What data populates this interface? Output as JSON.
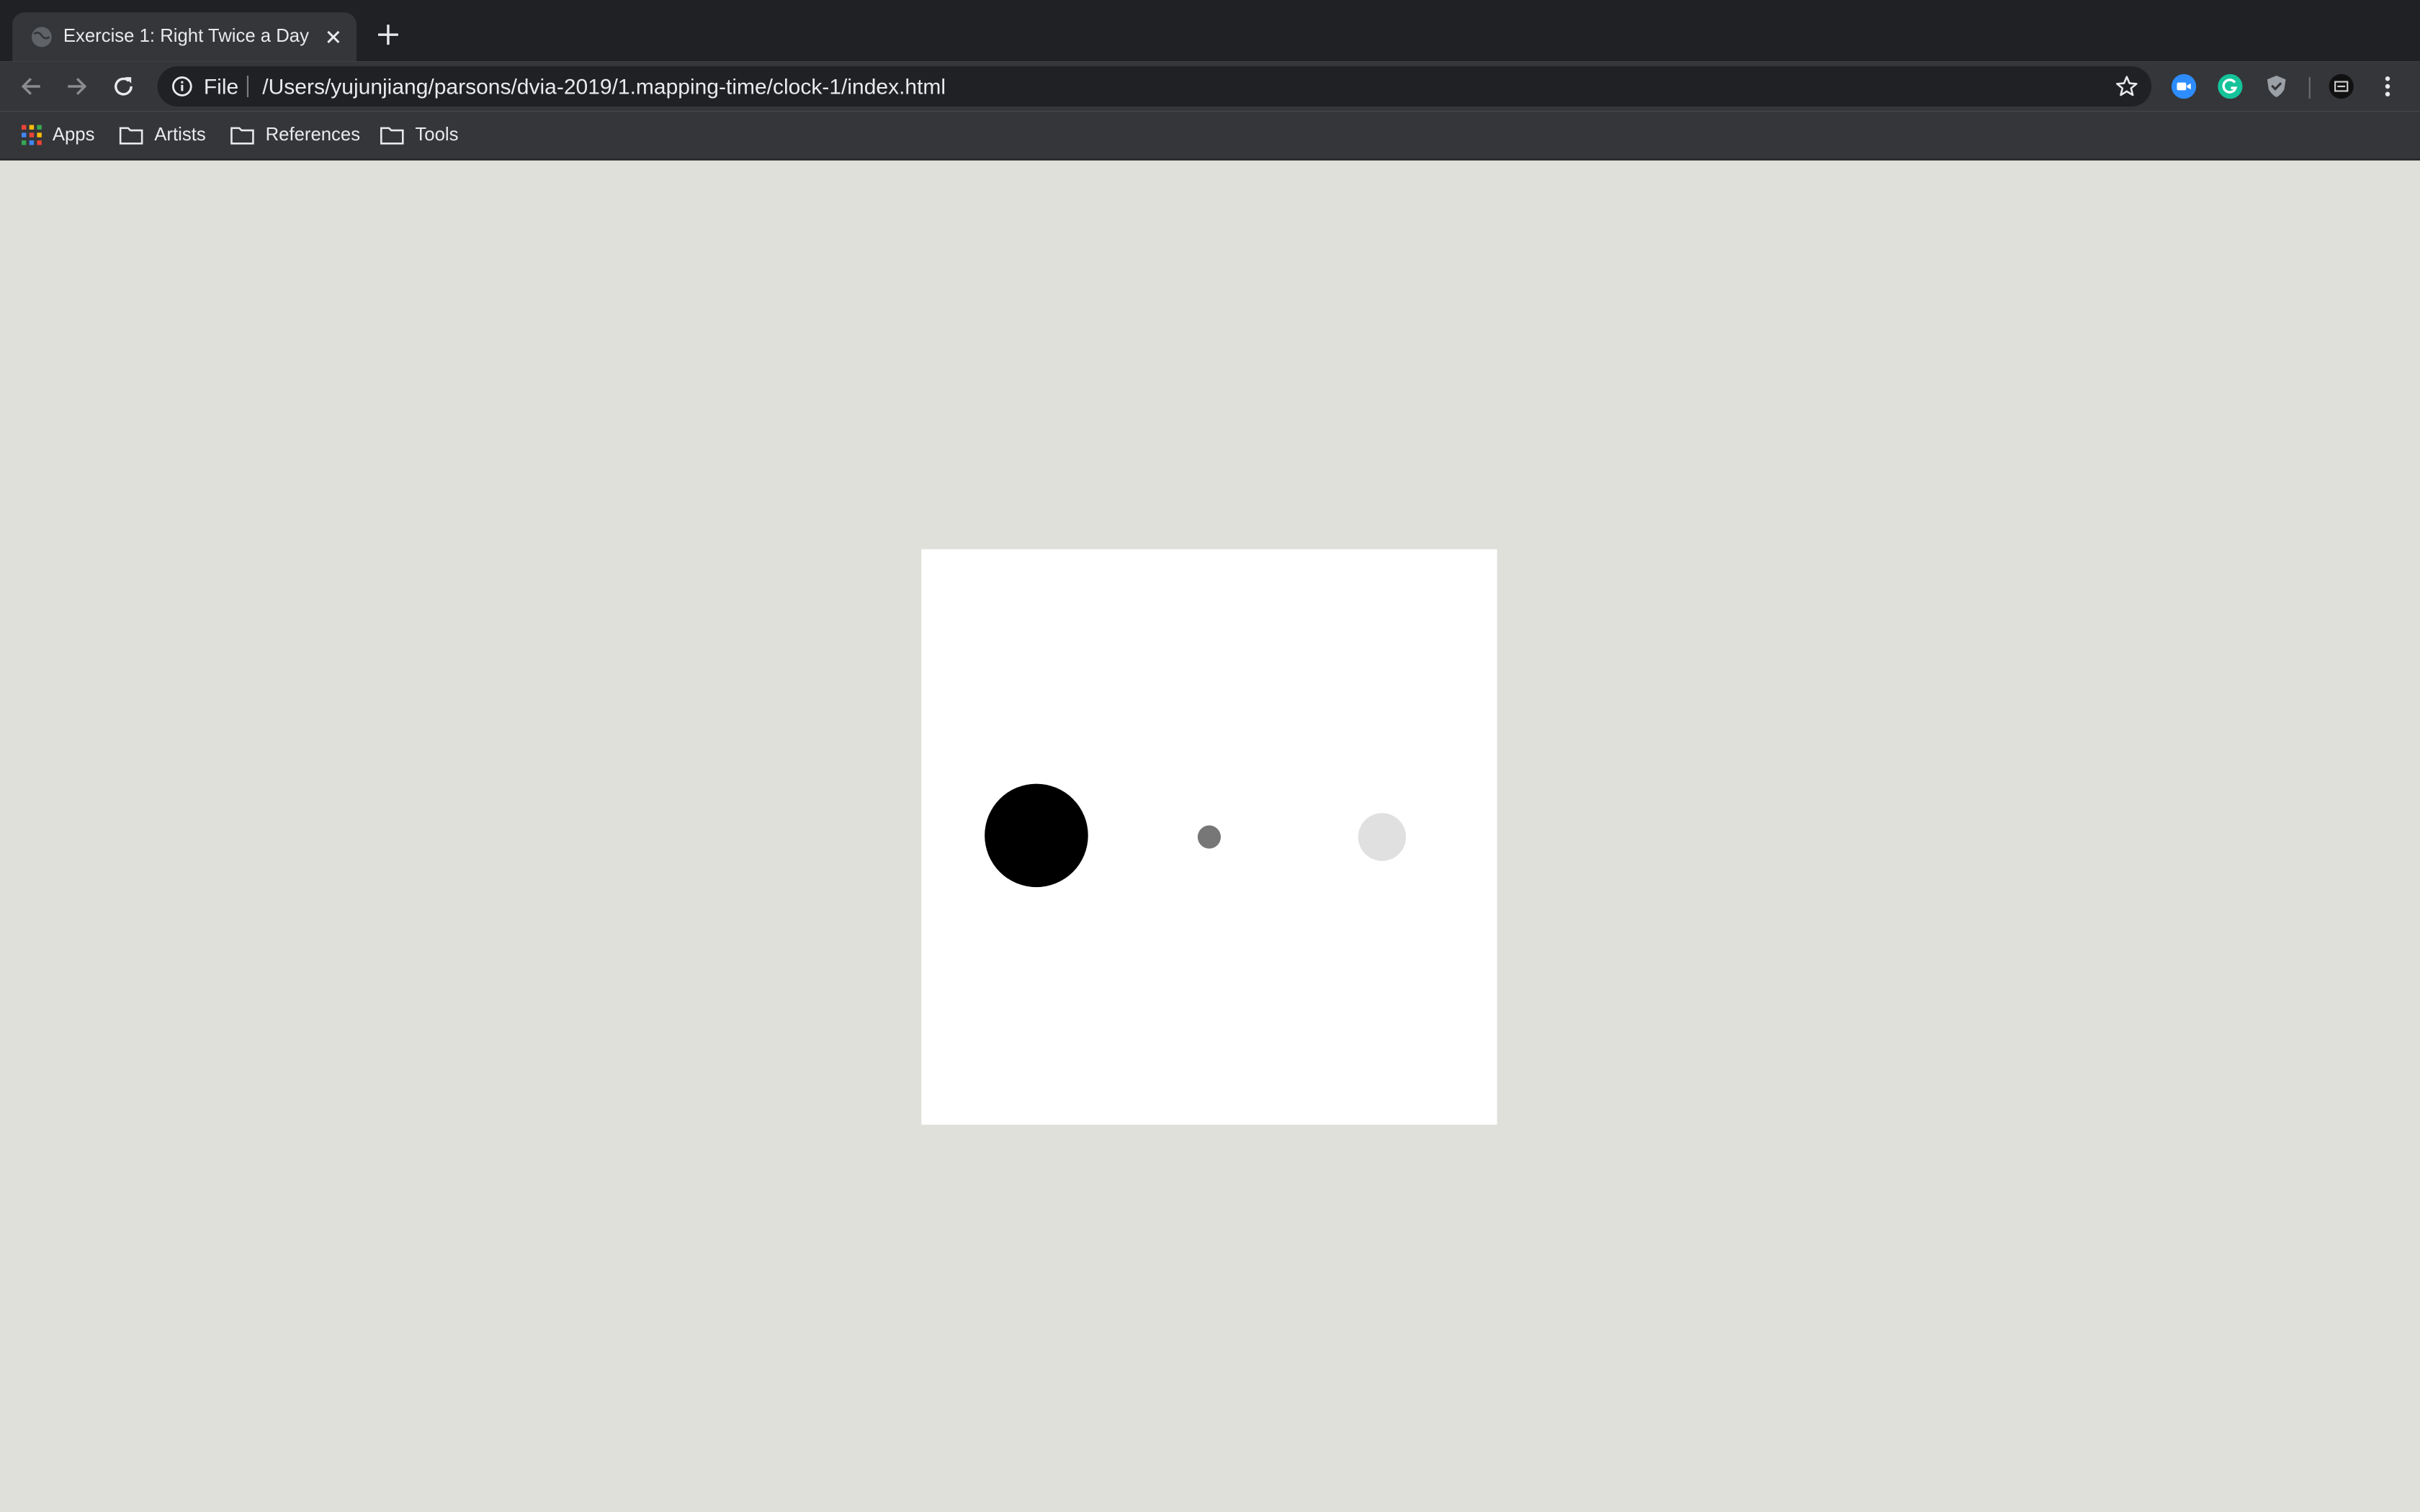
{
  "browser": {
    "tab": {
      "title": "Exercise 1: Right Twice a Day"
    },
    "omnibox": {
      "scheme": "File",
      "url": "/Users/yujunjiang/parsons/dvia-2019/1.mapping-time/clock-1/index.html"
    },
    "bookmarks": [
      {
        "label": "Apps",
        "icon": "apps-grid-icon"
      },
      {
        "label": "Artists",
        "icon": "folder-icon"
      },
      {
        "label": "References",
        "icon": "folder-icon"
      },
      {
        "label": "Tools",
        "icon": "folder-icon"
      }
    ],
    "extensions": [
      "zoom-extension-icon",
      "grammarly-extension-icon",
      "shield-extension-icon",
      "screen-extension-icon"
    ]
  },
  "page": {
    "clock": {
      "dots": [
        {
          "name": "hours-dot",
          "color": "#000000"
        },
        {
          "name": "minutes-dot",
          "color": "#777777"
        },
        {
          "name": "seconds-dot",
          "color": "#e0e0e0"
        }
      ]
    }
  },
  "colors": {
    "titlebar": "#202124",
    "toolbar": "#35363a",
    "page_background": "#dfe0da",
    "canvas": "#ffffff"
  }
}
